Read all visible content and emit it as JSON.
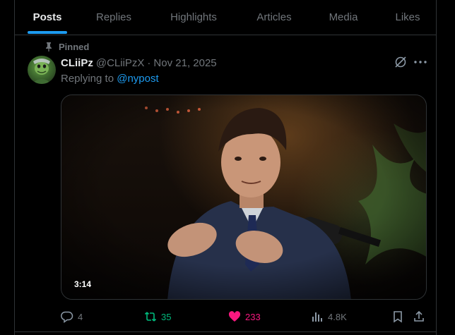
{
  "tabs": [
    {
      "label": "Posts",
      "active": true
    },
    {
      "label": "Replies",
      "active": false
    },
    {
      "label": "Highlights",
      "active": false
    },
    {
      "label": "Articles",
      "active": false
    },
    {
      "label": "Media",
      "active": false
    },
    {
      "label": "Likes",
      "active": false
    }
  ],
  "post": {
    "pinned_label": "Pinned",
    "display_name": "CLiiPz",
    "handle": "@CLiiPzX",
    "separator": "·",
    "date": "Nov 21, 2025",
    "replying_prefix": "Replying to ",
    "replying_to": "@nypost",
    "video_duration": "3:14",
    "stats": {
      "replies": "4",
      "reposts": "35",
      "likes": "233",
      "views": "4.8K"
    }
  },
  "colors": {
    "accent": "#1d9bf0",
    "repost": "#00ba7c",
    "like": "#f91880",
    "muted": "#71767b"
  },
  "icons": {
    "pin": "pin-icon",
    "grok": "grok-icon",
    "more": "more-icon",
    "reply": "reply-icon",
    "repost": "repost-icon",
    "like": "heart-icon",
    "views": "views-icon",
    "bookmark": "bookmark-icon",
    "share": "share-icon"
  }
}
